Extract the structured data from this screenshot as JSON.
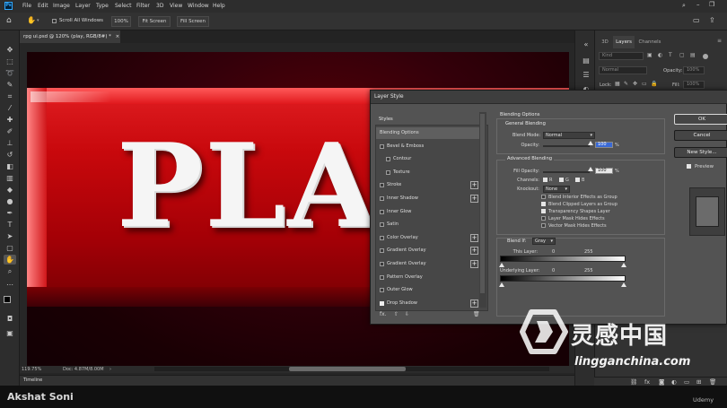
{
  "app": {
    "logo_text": "Ps"
  },
  "menu": [
    "File",
    "Edit",
    "Image",
    "Layer",
    "Type",
    "Select",
    "Filter",
    "3D",
    "View",
    "Window",
    "Help"
  ],
  "options_bar": {
    "scroll_all_windows": "Scroll All Windows",
    "zoom_100": "100%",
    "fit_screen": "Fit Screen",
    "fill_screen": "Fill Screen"
  },
  "document": {
    "tab_title": "rpg ui.psd @ 120% (play, RGB/8#) *",
    "close_glyph": "×",
    "artwork_text": "PLAY",
    "zoom": "119.75%",
    "doc_info": "Doc: 4.87M/8.00M"
  },
  "timeline": {
    "label": "Timeline"
  },
  "layers_panel": {
    "tabs": [
      "3D",
      "Layers",
      "Channels"
    ],
    "active_tab": "Layers",
    "kind_placeholder": "Kind",
    "blend_mode": "Normal",
    "opacity_label": "Opacity:",
    "opacity_value": "100%",
    "lock_label": "Lock:",
    "fill_label": "Fill:",
    "fill_value": "100%"
  },
  "layer_style": {
    "title": "Layer Style",
    "list_header": "Styles",
    "items": [
      {
        "label": "Blending Options",
        "checkbox": false,
        "plus": false,
        "active": true,
        "indent": 0
      },
      {
        "label": "Bevel & Emboss",
        "checkbox": true,
        "checked": false,
        "plus": false,
        "indent": 0
      },
      {
        "label": "Contour",
        "checkbox": true,
        "checked": false,
        "plus": false,
        "indent": 1
      },
      {
        "label": "Texture",
        "checkbox": true,
        "checked": false,
        "plus": false,
        "indent": 1
      },
      {
        "label": "Stroke",
        "checkbox": true,
        "checked": false,
        "plus": true,
        "indent": 0
      },
      {
        "label": "Inner Shadow",
        "checkbox": true,
        "checked": false,
        "plus": true,
        "indent": 0
      },
      {
        "label": "Inner Glow",
        "checkbox": true,
        "checked": false,
        "plus": false,
        "indent": 0
      },
      {
        "label": "Satin",
        "checkbox": true,
        "checked": false,
        "plus": false,
        "indent": 0
      },
      {
        "label": "Color Overlay",
        "checkbox": true,
        "checked": false,
        "plus": true,
        "indent": 0
      },
      {
        "label": "Gradient Overlay",
        "checkbox": true,
        "checked": false,
        "plus": true,
        "indent": 0
      },
      {
        "label": "Gradient Overlay",
        "checkbox": true,
        "checked": false,
        "plus": true,
        "indent": 0
      },
      {
        "label": "Pattern Overlay",
        "checkbox": true,
        "checked": false,
        "plus": false,
        "indent": 0
      },
      {
        "label": "Outer Glow",
        "checkbox": true,
        "checked": false,
        "plus": false,
        "indent": 0
      },
      {
        "label": "Drop Shadow",
        "checkbox": true,
        "checked": true,
        "plus": true,
        "indent": 0
      }
    ],
    "fx_label": "fx.",
    "blending_options": {
      "title": "Blending Options",
      "general_title": "General Blending",
      "blend_mode_label": "Blend Mode:",
      "blend_mode_value": "Normal",
      "opacity_label": "Opacity:",
      "opacity_value": "100",
      "percent": "%",
      "advanced_title": "Advanced Blending",
      "fill_opacity_label": "Fill Opacity:",
      "fill_opacity_value": "100",
      "channels_label": "Channels:",
      "channels": [
        "R",
        "G",
        "B"
      ],
      "knockout_label": "Knockout:",
      "knockout_value": "None",
      "options": [
        {
          "label": "Blend Interior Effects as Group",
          "checked": false
        },
        {
          "label": "Blend Clipped Layers as Group",
          "checked": true
        },
        {
          "label": "Transparency Shapes Layer",
          "checked": true
        },
        {
          "label": "Layer Mask Hides Effects",
          "checked": false
        },
        {
          "label": "Vector Mask Hides Effects",
          "checked": false
        }
      ],
      "blend_if_label": "Blend If:",
      "blend_if_value": "Gray",
      "this_layer_label": "This Layer:",
      "this_layer_min": "0",
      "this_layer_max": "255",
      "underlying_label": "Underlying Layer:",
      "underlying_min": "0",
      "underlying_max": "255"
    },
    "buttons": {
      "ok": "OK",
      "cancel": "Cancel",
      "new_style": "New Style..."
    },
    "preview_label": "Preview",
    "preview_checked": true
  },
  "video": {
    "presenter": "Akshat Soni",
    "platform": "Udemy"
  },
  "watermark": {
    "chinese": "灵感中国",
    "url": "lingganchina.com"
  },
  "colors": {
    "ps_blue": "#31a8ff",
    "workspace_bg": "#262626",
    "panel_bg": "#323232",
    "dialog_bg": "#535353",
    "plate_red": "#c8080c",
    "button_text_white": "#f5f5f5"
  }
}
